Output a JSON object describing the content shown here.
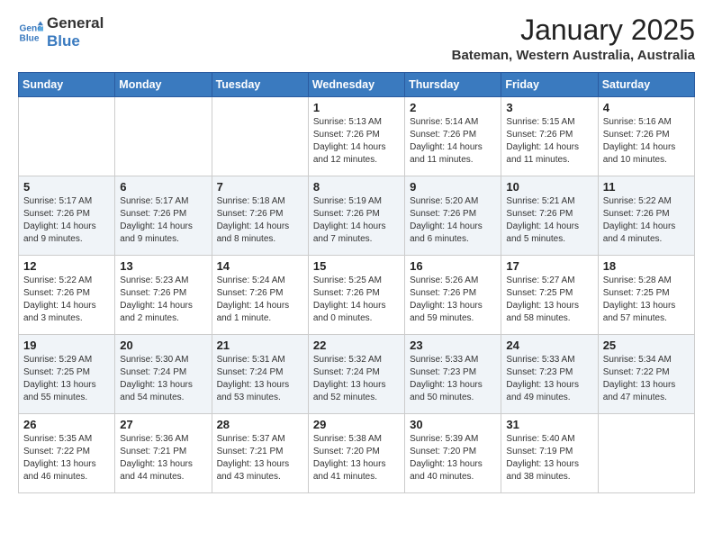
{
  "logo": {
    "line1": "General",
    "line2": "Blue"
  },
  "title": "January 2025",
  "location": "Bateman, Western Australia, Australia",
  "weekdays": [
    "Sunday",
    "Monday",
    "Tuesday",
    "Wednesday",
    "Thursday",
    "Friday",
    "Saturday"
  ],
  "weeks": [
    [
      {
        "day": "",
        "info": ""
      },
      {
        "day": "",
        "info": ""
      },
      {
        "day": "",
        "info": ""
      },
      {
        "day": "1",
        "info": "Sunrise: 5:13 AM\nSunset: 7:26 PM\nDaylight: 14 hours\nand 12 minutes."
      },
      {
        "day": "2",
        "info": "Sunrise: 5:14 AM\nSunset: 7:26 PM\nDaylight: 14 hours\nand 11 minutes."
      },
      {
        "day": "3",
        "info": "Sunrise: 5:15 AM\nSunset: 7:26 PM\nDaylight: 14 hours\nand 11 minutes."
      },
      {
        "day": "4",
        "info": "Sunrise: 5:16 AM\nSunset: 7:26 PM\nDaylight: 14 hours\nand 10 minutes."
      }
    ],
    [
      {
        "day": "5",
        "info": "Sunrise: 5:17 AM\nSunset: 7:26 PM\nDaylight: 14 hours\nand 9 minutes."
      },
      {
        "day": "6",
        "info": "Sunrise: 5:17 AM\nSunset: 7:26 PM\nDaylight: 14 hours\nand 9 minutes."
      },
      {
        "day": "7",
        "info": "Sunrise: 5:18 AM\nSunset: 7:26 PM\nDaylight: 14 hours\nand 8 minutes."
      },
      {
        "day": "8",
        "info": "Sunrise: 5:19 AM\nSunset: 7:26 PM\nDaylight: 14 hours\nand 7 minutes."
      },
      {
        "day": "9",
        "info": "Sunrise: 5:20 AM\nSunset: 7:26 PM\nDaylight: 14 hours\nand 6 minutes."
      },
      {
        "day": "10",
        "info": "Sunrise: 5:21 AM\nSunset: 7:26 PM\nDaylight: 14 hours\nand 5 minutes."
      },
      {
        "day": "11",
        "info": "Sunrise: 5:22 AM\nSunset: 7:26 PM\nDaylight: 14 hours\nand 4 minutes."
      }
    ],
    [
      {
        "day": "12",
        "info": "Sunrise: 5:22 AM\nSunset: 7:26 PM\nDaylight: 14 hours\nand 3 minutes."
      },
      {
        "day": "13",
        "info": "Sunrise: 5:23 AM\nSunset: 7:26 PM\nDaylight: 14 hours\nand 2 minutes."
      },
      {
        "day": "14",
        "info": "Sunrise: 5:24 AM\nSunset: 7:26 PM\nDaylight: 14 hours\nand 1 minute."
      },
      {
        "day": "15",
        "info": "Sunrise: 5:25 AM\nSunset: 7:26 PM\nDaylight: 14 hours\nand 0 minutes."
      },
      {
        "day": "16",
        "info": "Sunrise: 5:26 AM\nSunset: 7:26 PM\nDaylight: 13 hours\nand 59 minutes."
      },
      {
        "day": "17",
        "info": "Sunrise: 5:27 AM\nSunset: 7:25 PM\nDaylight: 13 hours\nand 58 minutes."
      },
      {
        "day": "18",
        "info": "Sunrise: 5:28 AM\nSunset: 7:25 PM\nDaylight: 13 hours\nand 57 minutes."
      }
    ],
    [
      {
        "day": "19",
        "info": "Sunrise: 5:29 AM\nSunset: 7:25 PM\nDaylight: 13 hours\nand 55 minutes."
      },
      {
        "day": "20",
        "info": "Sunrise: 5:30 AM\nSunset: 7:24 PM\nDaylight: 13 hours\nand 54 minutes."
      },
      {
        "day": "21",
        "info": "Sunrise: 5:31 AM\nSunset: 7:24 PM\nDaylight: 13 hours\nand 53 minutes."
      },
      {
        "day": "22",
        "info": "Sunrise: 5:32 AM\nSunset: 7:24 PM\nDaylight: 13 hours\nand 52 minutes."
      },
      {
        "day": "23",
        "info": "Sunrise: 5:33 AM\nSunset: 7:23 PM\nDaylight: 13 hours\nand 50 minutes."
      },
      {
        "day": "24",
        "info": "Sunrise: 5:33 AM\nSunset: 7:23 PM\nDaylight: 13 hours\nand 49 minutes."
      },
      {
        "day": "25",
        "info": "Sunrise: 5:34 AM\nSunset: 7:22 PM\nDaylight: 13 hours\nand 47 minutes."
      }
    ],
    [
      {
        "day": "26",
        "info": "Sunrise: 5:35 AM\nSunset: 7:22 PM\nDaylight: 13 hours\nand 46 minutes."
      },
      {
        "day": "27",
        "info": "Sunrise: 5:36 AM\nSunset: 7:21 PM\nDaylight: 13 hours\nand 44 minutes."
      },
      {
        "day": "28",
        "info": "Sunrise: 5:37 AM\nSunset: 7:21 PM\nDaylight: 13 hours\nand 43 minutes."
      },
      {
        "day": "29",
        "info": "Sunrise: 5:38 AM\nSunset: 7:20 PM\nDaylight: 13 hours\nand 41 minutes."
      },
      {
        "day": "30",
        "info": "Sunrise: 5:39 AM\nSunset: 7:20 PM\nDaylight: 13 hours\nand 40 minutes."
      },
      {
        "day": "31",
        "info": "Sunrise: 5:40 AM\nSunset: 7:19 PM\nDaylight: 13 hours\nand 38 minutes."
      },
      {
        "day": "",
        "info": ""
      }
    ]
  ]
}
